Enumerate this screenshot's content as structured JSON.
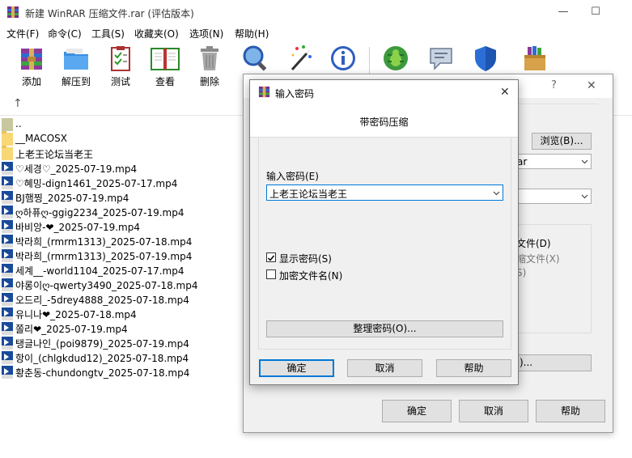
{
  "window": {
    "title": "新建 WinRAR 压缩文件.rar (评估版本)",
    "min": "—",
    "max": "☐",
    "close": "✕"
  },
  "menu": [
    "文件(F)",
    "命令(C)",
    "工具(S)",
    "收藏夹(O)",
    "选项(N)",
    "帮助(H)"
  ],
  "toolbar": {
    "add": "添加",
    "extract": "解压到",
    "test": "测试",
    "view": "查看",
    "delete": "删除"
  },
  "pathbar": {
    "up_arrow": "↑"
  },
  "files": [
    {
      "name": "..",
      "type": "parent"
    },
    {
      "name": "__MACOSX",
      "type": "folder"
    },
    {
      "name": "上老王论坛当老王",
      "type": "folder"
    },
    {
      "name": "♡세경♡_2025-07-19.mp4",
      "type": "mp4"
    },
    {
      "name": "♡혜밍-dign1461_2025-07-17.mp4",
      "type": "mp4"
    },
    {
      "name": "BJ햄찡_2025-07-19.mp4",
      "type": "mp4"
    },
    {
      "name": "ღ하퓨ღ-ggig2234_2025-07-19.mp4",
      "type": "mp4"
    },
    {
      "name": "바비앙-❤_2025-07-19.mp4",
      "type": "mp4"
    },
    {
      "name": "박라희_(rmrm1313)_2025-07-18.mp4",
      "type": "mp4"
    },
    {
      "name": "박라희_(rmrm1313)_2025-07-19.mp4",
      "type": "mp4"
    },
    {
      "name": "세계__-world1104_2025-07-17.mp4",
      "type": "mp4"
    },
    {
      "name": "야롱이ღ-qwerty3490_2025-07-18.mp4",
      "type": "mp4"
    },
    {
      "name": "오드리_-5drey4888_2025-07-18.mp4",
      "type": "mp4"
    },
    {
      "name": "유니나❤_2025-07-18.mp4",
      "type": "mp4"
    },
    {
      "name": "쫄리❤_2025-07-19.mp4",
      "type": "mp4"
    },
    {
      "name": "탱글나인_(poi9879)_2025-07-19.mp4",
      "type": "mp4"
    },
    {
      "name": "항이_(chlgkdud12)_2025-07-18.mp4",
      "type": "mp4"
    },
    {
      "name": "황춘동-chundongtv_2025-07-18.mp4",
      "type": "mp4"
    }
  ],
  "bg_dialog": {
    "help_q": "?",
    "close": "✕",
    "browse": "浏览(B)...",
    "format_partial": "ar",
    "opt1": "文件(D)",
    "opt2": "缩文件(X)",
    "opt3": "S)",
    "btn_partial": ")...",
    "ok": "确定",
    "cancel": "取消",
    "help": "帮助"
  },
  "pw_dialog": {
    "title": "输入密码",
    "close": "✕",
    "heading": "带密码压缩",
    "label": "输入密码(E)",
    "value": "上老王论坛当老王",
    "show_password": "显示密码(S)",
    "encrypt_names": "加密文件名(N)",
    "organize": "整理密码(O)...",
    "ok": "确定",
    "cancel": "取消",
    "help": "帮助"
  },
  "colors": {
    "mp4_icon": "#1a4a9a",
    "folder": "#f8d775",
    "focus_border": "#0078d7"
  }
}
